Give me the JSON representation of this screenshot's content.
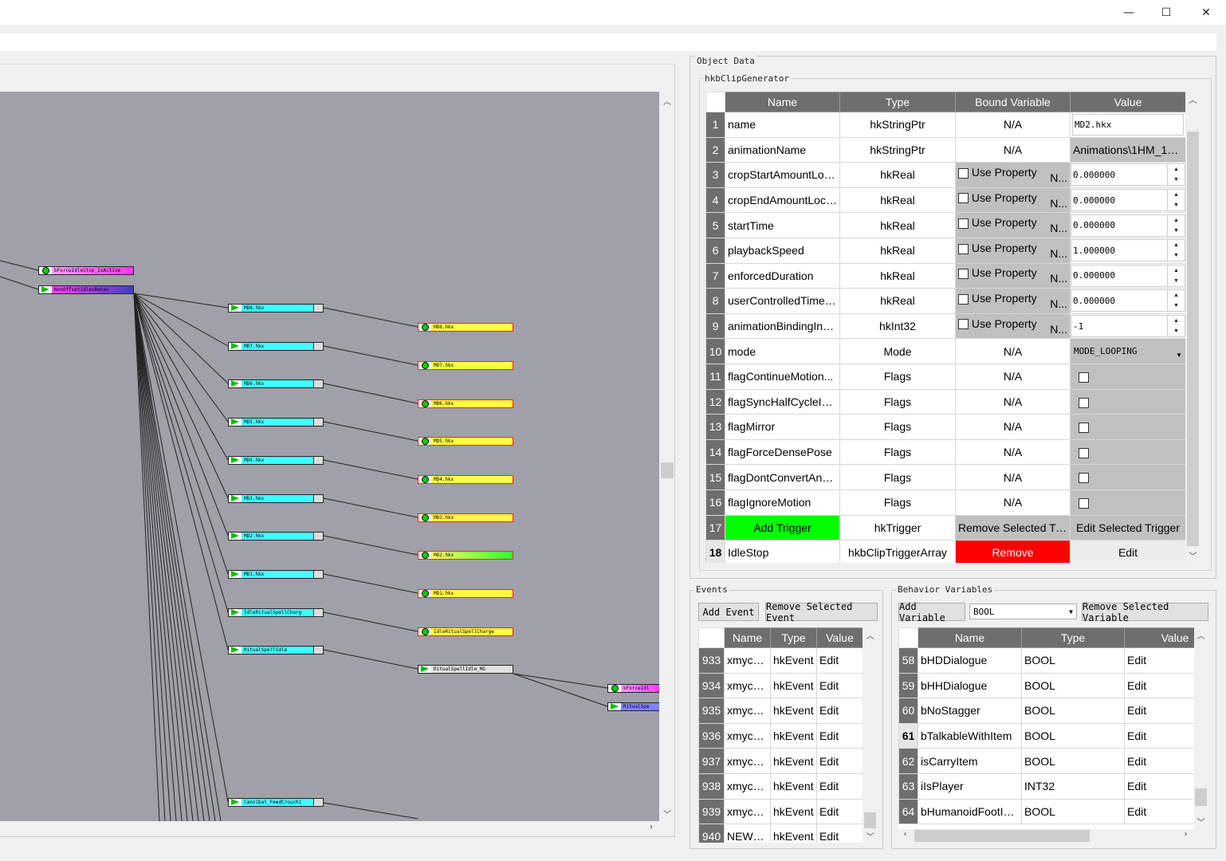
{
  "window": {
    "minimize_glyph": "—",
    "maximize_glyph": "☐",
    "close_glyph": "✕"
  },
  "object_data": {
    "label": "Object Data",
    "class_label": "hkbClipGenerator",
    "columns": [
      "Name",
      "Type",
      "Bound Variable",
      "Value"
    ],
    "rows": [
      {
        "n": "1",
        "name": "name",
        "type": "hkStringPtr",
        "bound": "N/A",
        "value": "MD2.hkx",
        "kind": "text"
      },
      {
        "n": "2",
        "name": "animationName",
        "type": "hkStringPtr",
        "bound": "N/A",
        "value": "Animations\\1HM_1st...",
        "kind": "plain"
      },
      {
        "n": "3",
        "name": "cropStartAmountLoc...",
        "type": "hkReal",
        "bound": "Use Property",
        "bound_suffix": "N...",
        "value": "0.000000",
        "kind": "spin"
      },
      {
        "n": "4",
        "name": "cropEndAmountLoca...",
        "type": "hkReal",
        "bound": "Use Property",
        "bound_suffix": "N...",
        "value": "0.000000",
        "kind": "spin"
      },
      {
        "n": "5",
        "name": "startTime",
        "type": "hkReal",
        "bound": "Use Property",
        "bound_suffix": "N...",
        "value": "0.000000",
        "kind": "spin"
      },
      {
        "n": "6",
        "name": "playbackSpeed",
        "type": "hkReal",
        "bound": "Use Property",
        "bound_suffix": "N...",
        "value": "1.000000",
        "kind": "spin"
      },
      {
        "n": "7",
        "name": "enforcedDuration",
        "type": "hkReal",
        "bound": "Use Property",
        "bound_suffix": "N...",
        "value": "0.000000",
        "kind": "spin"
      },
      {
        "n": "8",
        "name": "userControlledTimeF...",
        "type": "hkReal",
        "bound": "Use Property",
        "bound_suffix": "N...",
        "value": "0.000000",
        "kind": "spin"
      },
      {
        "n": "9",
        "name": "animationBindingInd...",
        "type": "hkInt32",
        "bound": "Use Property",
        "bound_suffix": "N...",
        "value": "-1",
        "kind": "spin"
      },
      {
        "n": "10",
        "name": "mode",
        "type": "Mode",
        "bound": "N/A",
        "value": "MODE_LOOPING",
        "kind": "combo"
      },
      {
        "n": "11",
        "name": "flagContinueMotion...",
        "type": "Flags",
        "bound": "N/A",
        "value": "",
        "kind": "check"
      },
      {
        "n": "12",
        "name": "flagSyncHalfCycleInP...",
        "type": "Flags",
        "bound": "N/A",
        "value": "",
        "kind": "check"
      },
      {
        "n": "13",
        "name": "flagMirror",
        "type": "Flags",
        "bound": "N/A",
        "value": "",
        "kind": "check"
      },
      {
        "n": "14",
        "name": "flagForceDensePose",
        "type": "Flags",
        "bound": "N/A",
        "value": "",
        "kind": "check"
      },
      {
        "n": "15",
        "name": "flagDontConvertAnn...",
        "type": "Flags",
        "bound": "N/A",
        "value": "",
        "kind": "check"
      },
      {
        "n": "16",
        "name": "flagIgnoreMotion",
        "type": "Flags",
        "bound": "N/A",
        "value": "",
        "kind": "check"
      }
    ],
    "row17": {
      "n": "17",
      "add_trigger": "Add Trigger",
      "type": "hkTrigger",
      "remove_selected": "Remove Selected Tri...",
      "edit_selected": "Edit Selected Trigger"
    },
    "row18": {
      "n": "18",
      "name": "IdleStop",
      "type": "hkbClipTriggerArray",
      "remove": "Remove",
      "edit": "Edit"
    }
  },
  "events": {
    "label": "Events",
    "add_button": "Add Event",
    "remove_button": "Remove Selected Event",
    "columns": [
      "Name",
      "Type",
      "Value"
    ],
    "rows": [
      {
        "n": "933",
        "name": "xmyc0...",
        "type": "hkEvent",
        "value": "Edit"
      },
      {
        "n": "934",
        "name": "xmyc0...",
        "type": "hkEvent",
        "value": "Edit"
      },
      {
        "n": "935",
        "name": "xmyc0...",
        "type": "hkEvent",
        "value": "Edit"
      },
      {
        "n": "936",
        "name": "xmyc0...",
        "type": "hkEvent",
        "value": "Edit"
      },
      {
        "n": "937",
        "name": "xmyc0...",
        "type": "hkEvent",
        "value": "Edit"
      },
      {
        "n": "938",
        "name": "xmyc0...",
        "type": "hkEvent",
        "value": "Edit"
      },
      {
        "n": "939",
        "name": "xmyc0...",
        "type": "hkEvent",
        "value": "Edit"
      },
      {
        "n": "940",
        "name": "NEW_E...",
        "type": "hkEvent",
        "value": "Edit"
      }
    ]
  },
  "variables": {
    "label": "Behavior Variables",
    "add_button": "Add Variable",
    "type_select": "BOOL",
    "remove_button": "Remove Selected Variable",
    "columns": [
      "Name",
      "Type",
      "Value"
    ],
    "rows": [
      {
        "n": "58",
        "name": "bHDDialogue",
        "type": "BOOL",
        "value": "Edit"
      },
      {
        "n": "59",
        "name": "bHHDialogue",
        "type": "BOOL",
        "value": "Edit"
      },
      {
        "n": "60",
        "name": "bNoStagger",
        "type": "BOOL",
        "value": "Edit"
      },
      {
        "n": "61",
        "name": "bTalkableWithItem",
        "type": "BOOL",
        "value": "Edit",
        "selected": true
      },
      {
        "n": "62",
        "name": "isCarryItem",
        "type": "BOOL",
        "value": "Edit"
      },
      {
        "n": "63",
        "name": "iIsPlayer",
        "type": "INT32",
        "value": "Edit"
      },
      {
        "n": "64",
        "name": "bHumanoidFootIK...",
        "type": "BOOL",
        "value": "Edit"
      }
    ]
  },
  "graph": {
    "nodes": [
      {
        "id": "bForceIdleStop",
        "label": "bForceIdleStop_IsActive",
        "icon": "circle",
        "color": "#ff40ff"
      },
      {
        "id": "NonOffset",
        "label": "NonOffsetIdlesBehav",
        "icon": "triangle",
        "color": "#4040c0"
      },
      {
        "id": "md8",
        "label": "MD8.hkx",
        "icon": "triangle",
        "color": "#40ffff"
      },
      {
        "id": "md7",
        "label": "MD7.hkx",
        "icon": "triangle",
        "color": "#40ffff"
      },
      {
        "id": "md6",
        "label": "MD6.hkx",
        "icon": "triangle",
        "color": "#40ffff"
      },
      {
        "id": "md5",
        "label": "MD5.hkx",
        "icon": "triangle",
        "color": "#40ffff"
      },
      {
        "id": "md4",
        "label": "MD4.hkx",
        "icon": "triangle",
        "color": "#40ffff"
      },
      {
        "id": "md3",
        "label": "MD3.hkx",
        "icon": "triangle",
        "color": "#40ffff"
      },
      {
        "id": "md2",
        "label": "MD2.hkx",
        "icon": "triangle",
        "color": "#40ffff"
      },
      {
        "id": "md1",
        "label": "MD1.hkx",
        "icon": "triangle",
        "color": "#40ffff"
      },
      {
        "id": "irsc",
        "label": "IdleRitualSpellCharg",
        "icon": "triangle",
        "color": "#40ffff"
      },
      {
        "id": "rsi",
        "label": "RitualSpellIdle",
        "icon": "triangle",
        "color": "#40ffff"
      },
      {
        "id": "cfc",
        "label": "Cannibal_FeedCrouchi",
        "icon": "triangle",
        "color": "#40ffff"
      },
      {
        "id": "c8",
        "label": "MD8.hkx",
        "icon": "circle",
        "color": "#ffff40"
      },
      {
        "id": "c7",
        "label": "MD7.hkx",
        "icon": "circle",
        "color": "#ffff40"
      },
      {
        "id": "c6",
        "label": "MD6.hkx",
        "icon": "circle",
        "color": "#ffff40"
      },
      {
        "id": "c5",
        "label": "MD5.hkx",
        "icon": "circle",
        "color": "#ffff40"
      },
      {
        "id": "c4",
        "label": "MD4.hkx",
        "icon": "circle",
        "color": "#ffff40"
      },
      {
        "id": "c3",
        "label": "MD3.hkx",
        "icon": "circle",
        "color": "#ffff40"
      },
      {
        "id": "c2",
        "label": "MD2.hkx",
        "icon": "circle",
        "color": "#40ff40"
      },
      {
        "id": "c1",
        "label": "MD1.hkx",
        "icon": "circle",
        "color": "#ffff40"
      },
      {
        "id": "cirsc",
        "label": "IdleRitualSpellCharge",
        "icon": "circle",
        "color": "#ffff40"
      },
      {
        "id": "rsim",
        "label": "RitualSpellIdle_MG",
        "icon": "triangle",
        "color": "#e0e0e0"
      },
      {
        "id": "bfi",
        "label": "bForceIdl",
        "icon": "circle",
        "color": "#ff40ff"
      },
      {
        "id": "rsp",
        "label": "RitualSpe",
        "icon": "triangle",
        "color": "#8080ff"
      }
    ]
  }
}
